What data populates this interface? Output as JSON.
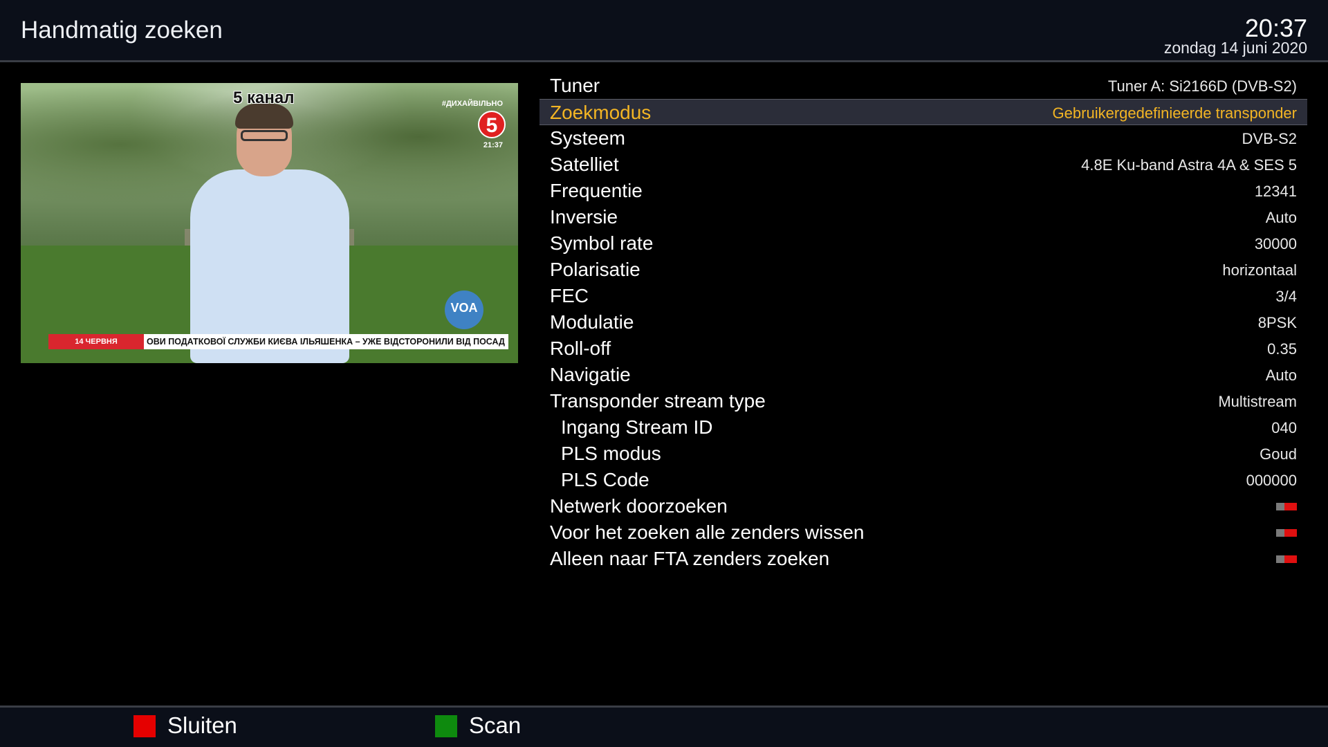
{
  "header": {
    "title": "Handmatig zoeken",
    "time": "20:37",
    "date": "zondag 14 juni 2020"
  },
  "preview": {
    "channel_name": "5 канал",
    "hashtag": "#ДИХАЙВІЛЬНО",
    "logo_number": "5",
    "overlay_time": "21:37",
    "voa_logo": "VOA",
    "ticker_date": "14 ЧЕРВНЯ",
    "ticker_text": "ОВИ ПОДАТКОВОЇ СЛУЖБИ КИЄВА ІЛЬЯШЕНКА – УЖЕ ВІДСТОРОНИЛИ ВІД ПОСАД"
  },
  "settings": {
    "rows": [
      {
        "label": "Tuner",
        "value": "Tuner A: Si2166D (DVB-S2)"
      },
      {
        "label": "Zoekmodus",
        "value": "Gebruikergedefinieerde transponder"
      },
      {
        "label": "Systeem",
        "value": "DVB-S2"
      },
      {
        "label": "Satelliet",
        "value": "4.8E Ku-band Astra 4A & SES 5"
      },
      {
        "label": "Frequentie",
        "value": "12341"
      },
      {
        "label": "Inversie",
        "value": "Auto"
      },
      {
        "label": "Symbol rate",
        "value": "30000"
      },
      {
        "label": "Polarisatie",
        "value": "horizontaal"
      },
      {
        "label": "FEC",
        "value": "3/4"
      },
      {
        "label": "Modulatie",
        "value": "8PSK"
      },
      {
        "label": "Roll-off",
        "value": "0.35"
      },
      {
        "label": "Navigatie",
        "value": "Auto"
      },
      {
        "label": "Transponder stream type",
        "value": "Multistream"
      },
      {
        "label": "Ingang Stream ID",
        "value": "040"
      },
      {
        "label": "PLS modus",
        "value": "Goud"
      },
      {
        "label": "PLS Code",
        "value": "000000"
      },
      {
        "label": "Netwerk doorzoeken",
        "toggle": false
      },
      {
        "label": "Voor het zoeken alle zenders wissen",
        "toggle": false
      },
      {
        "label": "Alleen naar FTA zenders zoeken",
        "toggle": false
      }
    ],
    "selected_index": 1
  },
  "footer": {
    "red_label": "Sluiten",
    "green_label": "Scan"
  },
  "colors": {
    "highlight_text": "#f3b524",
    "toggle_off": "#e01010",
    "key_red": "#e50000",
    "key_green": "#0e8a0e"
  },
  "icons": {
    "red_key": "red-key-icon",
    "green_key": "green-key-icon",
    "toggle": "toggle-off-icon"
  }
}
